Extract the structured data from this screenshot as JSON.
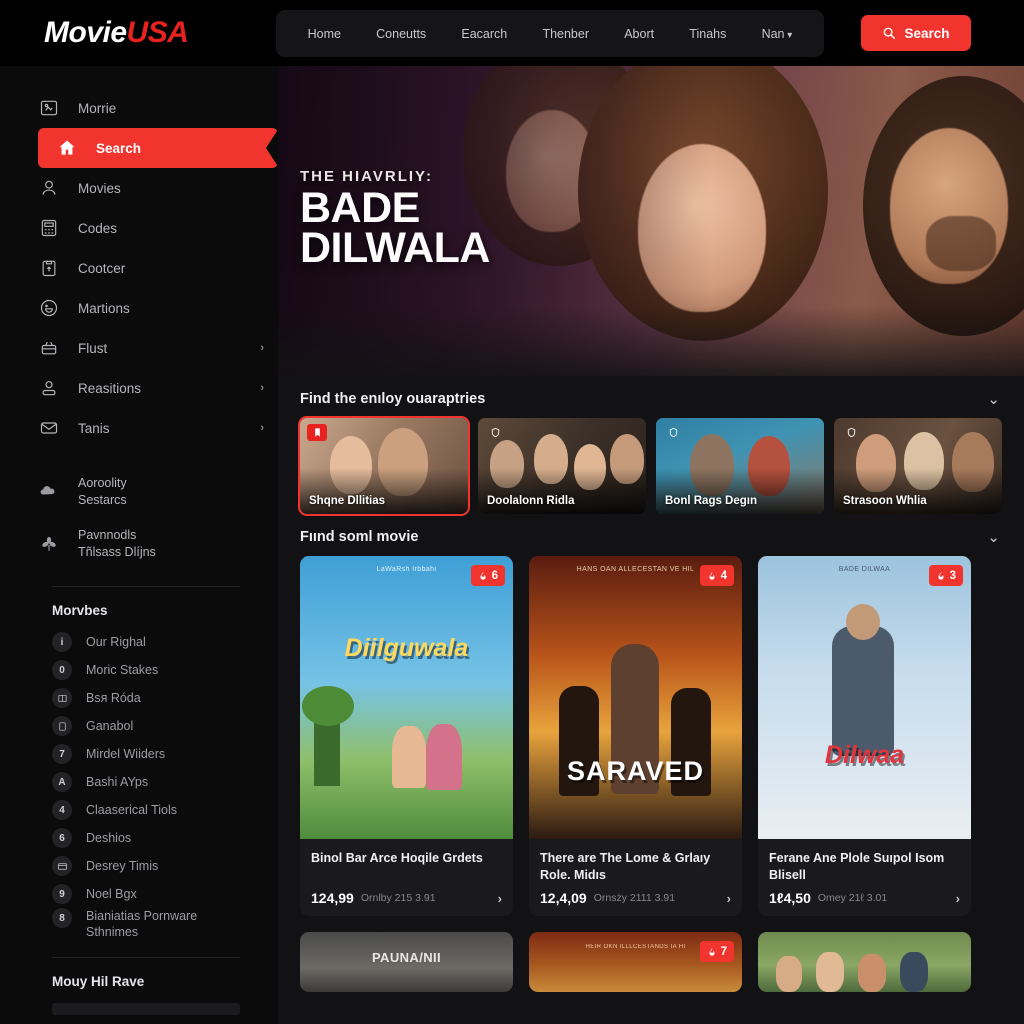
{
  "brand": {
    "name_white": "Movie",
    "name_red": "USA"
  },
  "colors": {
    "accent": "#f2342e",
    "brand_red": "#e8231f",
    "bg": "#0a0a0b",
    "panel": "#1a1a1d"
  },
  "topnav": {
    "items": [
      {
        "label": "Home"
      },
      {
        "label": "Coneutts"
      },
      {
        "label": "Eacarch"
      },
      {
        "label": "Thenber"
      },
      {
        "label": "Abort"
      },
      {
        "label": "Tinahs"
      },
      {
        "label": "Nan"
      }
    ],
    "search_button": {
      "label": "Search",
      "icon": "search-icon"
    }
  },
  "sidebar": {
    "nav": [
      {
        "label": "Morrie",
        "icon": "image-icon",
        "active": false,
        "chevron": false
      },
      {
        "label": "Search",
        "icon": "home-icon",
        "active": true,
        "chevron": false
      },
      {
        "label": "Movies",
        "icon": "user-icon",
        "active": false,
        "chevron": false
      },
      {
        "label": "Codes",
        "icon": "calculator-icon",
        "active": false,
        "chevron": false
      },
      {
        "label": "Cootcer",
        "icon": "clipboard-icon",
        "active": false,
        "chevron": false
      },
      {
        "label": "Martions",
        "icon": "smiley-icon",
        "active": false,
        "chevron": false
      },
      {
        "label": "Flust",
        "icon": "basket-icon",
        "active": false,
        "chevron": true
      },
      {
        "label": "Reasitions",
        "icon": "person-icon",
        "active": false,
        "chevron": true
      },
      {
        "label": "Tanis",
        "icon": "mail-icon",
        "active": false,
        "chevron": true
      }
    ],
    "two_line": [
      {
        "line1": "Aoroolity",
        "line2": "Sestarcs",
        "icon": "cloud-icon"
      },
      {
        "line1": "Pavnnodls",
        "line2": "Tñlsass Dlíjns",
        "icon": "leaf-icon"
      }
    ],
    "section_title": "Morvbes",
    "menu": [
      {
        "label": "Our Righal",
        "badge": "i"
      },
      {
        "label": "Moric Stakes",
        "badge": "0"
      },
      {
        "label": "Bsя Róda",
        "badge": "book-icon"
      },
      {
        "label": "Ganabol",
        "badge": "square-icon"
      },
      {
        "label": "Mirdel Wiiders",
        "badge": "7"
      },
      {
        "label": "Bashi AYps",
        "badge": "A"
      },
      {
        "label": "Claaserical Tiols",
        "badge": "4"
      },
      {
        "label": "Deshios",
        "badge": "6"
      },
      {
        "label": "Desrey Timis",
        "badge": "card-icon"
      },
      {
        "label": "Noel Bgx",
        "badge": "9"
      },
      {
        "label": "Bianiatias Pornware Sthnimes",
        "badge": "8"
      }
    ],
    "bottom_title": "Mouy Hil Rave"
  },
  "hero": {
    "subtitle": "THE HIAVRLIY:",
    "title_line1": "BADE",
    "title_line2": "DILWALA"
  },
  "sections": [
    {
      "title": "Find the enıloy ouaraptries",
      "chevron": "chevron-down-icon",
      "thumbs": [
        {
          "caption": "Shqne Dllitias",
          "selected": true,
          "tag": "bookmark-icon"
        },
        {
          "caption": "Doolalonn Ridla",
          "selected": false,
          "tag": "shield-icon"
        },
        {
          "caption": "Bonl Rags Degın",
          "selected": false,
          "tag": "shield-icon"
        },
        {
          "caption": "Strasoon Whlia",
          "selected": false,
          "tag": "shield-icon"
        }
      ]
    },
    {
      "title": "Fıınd soml movie",
      "chevron": "chevron-down-icon",
      "cards": [
        {
          "poster_top": "LaWaRsh Irbbahi",
          "poster_title": "Diilguwala",
          "badge": "6",
          "badge_icon": "flame-icon",
          "title": "Binol Bar Arce Hoqile Grdets",
          "price": "124,99",
          "meta": "Ornlby 215 3.91",
          "go": "chevron-right-icon"
        },
        {
          "poster_top": "HANS OAN ALLECESTAN VE HIL",
          "poster_title": "SARAVED",
          "badge": "4",
          "badge_icon": "flame-icon",
          "title": "There are The Lome & Grlaıy Role. Midıs",
          "price": "12,4,09",
          "meta": "Ornsży 2111 3.91",
          "go": "chevron-right-icon"
        },
        {
          "poster_top": "BADE DILWAA",
          "poster_title": "Dilwaa",
          "badge": "3",
          "badge_icon": "flame-icon",
          "title": "Ferane Ane Plole Suıpol Isom Blisell",
          "price": "1ℓ4,50",
          "meta": "Omey 21ℓ 3.01",
          "go": "chevron-right-icon"
        }
      ],
      "cards_row2": [
        {
          "poster_top": "PAUNA/NII",
          "badge": "",
          "badge_icon": ""
        },
        {
          "poster_top": "HEIR OKN ILLLCESTANDS IA HI",
          "badge": "7",
          "badge_icon": "flame-icon"
        },
        {
          "poster_top": "",
          "badge": "",
          "badge_icon": ""
        }
      ]
    }
  ]
}
